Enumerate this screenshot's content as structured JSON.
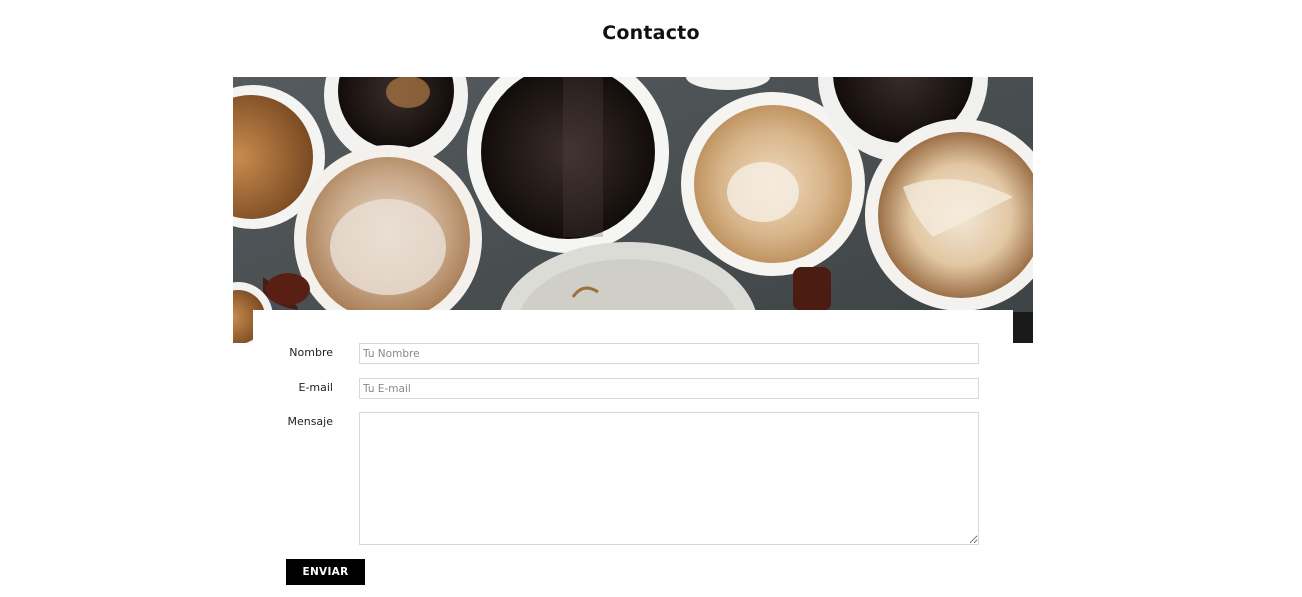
{
  "page": {
    "title": "Contacto"
  },
  "hero": {
    "image_name": "coffee-cups-photo"
  },
  "form": {
    "name_label": "Nombre",
    "name_placeholder": "Tu Nombre",
    "name_value": "",
    "email_label": "E-mail",
    "email_placeholder": "Tu E-mail",
    "email_value": "",
    "message_label": "Mensaje",
    "message_value": "",
    "submit_label": "ENVIAR"
  },
  "colors": {
    "background": "#ffffff",
    "button_bg": "#000000",
    "button_text": "#ffffff",
    "field_border": "#d9d9d9"
  }
}
